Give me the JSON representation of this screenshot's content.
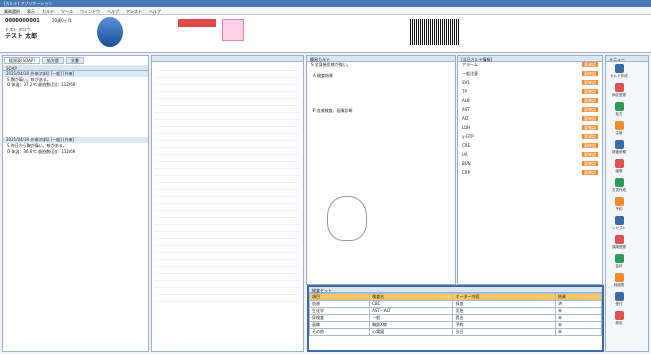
{
  "window_title": "[カルテ] アプリケーション",
  "menu": [
    "業務選択",
    "表示",
    "カルテ",
    "ツール",
    "ウィンドウ",
    "ヘルプ",
    "アシスト",
    "ヘルプ"
  ],
  "patient": {
    "id": "0000000001",
    "age": "20歳0ヶ月",
    "kana": "テスト タロウ",
    "name": "テスト 太郎",
    "sex": "男"
  },
  "tabs": [
    "経過表(SOAP)",
    "処方歴",
    "文書"
  ],
  "karte_header": "SOAP",
  "left_notes": [
    {
      "date": "2021/04/30 外来(内科) [一般] [外来]",
      "s": "S 胸が痛い。咳がある。",
      "o": "O 体温：37.2℃ 脈拍数(回)：112/69"
    },
    {
      "date": "2021/04/19 外来(内科) [一般] [外来]",
      "s": "S 昨日から胸が痛い。咳がある。",
      "o": "O 体温：36.6℃ 脈拍数(回)：112/69"
    }
  ],
  "sub_panel": {
    "title": "簡易カルテ",
    "tabs": [
      "全体",
      "カルテ",
      "処方",
      "検査"
    ],
    "left_text": "S 全身倦怠感が強い。",
    "labels": [
      "A 検査結果",
      "P 血液検査、画像診断"
    ]
  },
  "right_panel": {
    "title": "[当日カルテ情報]",
    "items": [
      "アラーム",
      "一般注意",
      "SV1",
      "TP",
      "ALB",
      "AST",
      "ALT",
      "LDH",
      "γ-GTP",
      "CRE",
      "UA",
      "BUN",
      "CRP"
    ],
    "tag": "要確認"
  },
  "sidebar": {
    "title": "メニュー",
    "items": [
      "カルテ作成",
      "病名登録",
      "処方",
      "注射",
      "検査依頼",
      "画像",
      "文書作成",
      "予約",
      "レセプト",
      "保険登録",
      "会計",
      "経過表",
      "受付",
      "設定"
    ]
  },
  "bottom_panel": {
    "title": "検査セット",
    "cols": [
      "項目",
      "検査名",
      "オーダー内容",
      "結果"
    ],
    "rows": [
      [
        "血液",
        "CBC",
        "採血",
        "済"
      ],
      [
        "生化学",
        "AST・ALT",
        "至急",
        "未"
      ],
      [
        "尿検査",
        "一般",
        "提出",
        "未"
      ],
      [
        "画像",
        "胸部X線",
        "予約",
        "未"
      ],
      [
        "その他",
        "心電図",
        "当日",
        "未"
      ]
    ]
  },
  "accent": "#3b6aa8"
}
